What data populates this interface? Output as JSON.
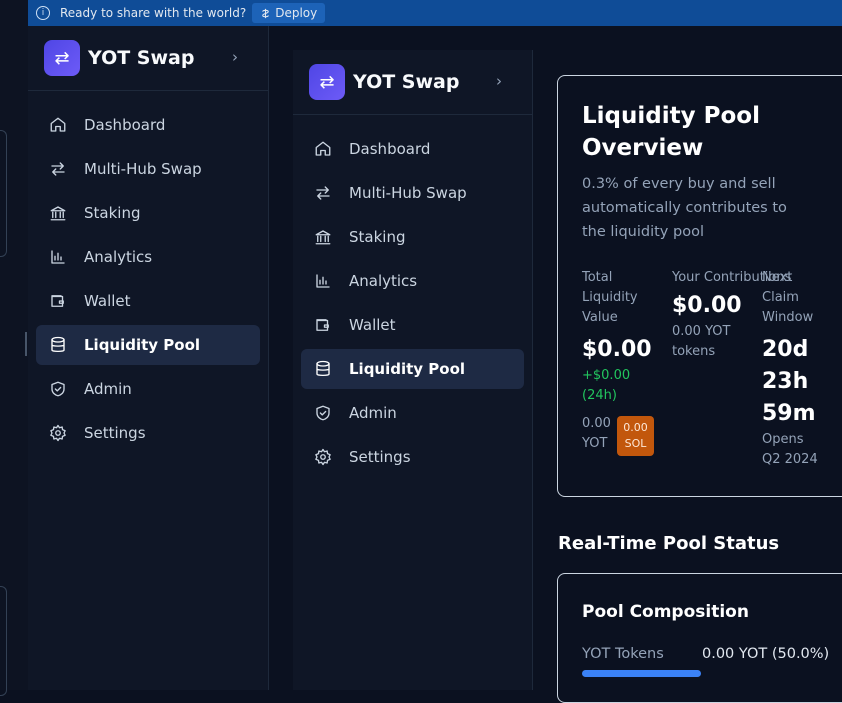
{
  "topbar": {
    "message": "Ready to share with the world?",
    "deploy_label": "Deploy"
  },
  "sidebar": {
    "brand": "YOT Swap",
    "items": [
      {
        "label": "Dashboard",
        "icon": "home-icon",
        "active": false
      },
      {
        "label": "Multi-Hub Swap",
        "icon": "swap-arrows-icon",
        "active": false
      },
      {
        "label": "Staking",
        "icon": "bank-icon",
        "active": false
      },
      {
        "label": "Analytics",
        "icon": "bar-chart-icon",
        "active": false
      },
      {
        "label": "Wallet",
        "icon": "wallet-icon",
        "active": false
      },
      {
        "label": "Liquidity Pool",
        "icon": "database-icon",
        "active": true
      },
      {
        "label": "Admin",
        "icon": "shield-check-icon",
        "active": false
      },
      {
        "label": "Settings",
        "icon": "gear-icon",
        "active": false
      }
    ]
  },
  "overview": {
    "title": "Liquidity Pool Overview",
    "description": "0.3% of every buy and sell automatically contributes to the liquidity pool",
    "total_label": "Total Liquidity Value",
    "total_value": "$0.00",
    "total_change": "+$0.00 (24h)",
    "yot_amount": "0.00 YOT",
    "sol_amount": "0.00 SOL",
    "contrib_label": "Your Contributions",
    "contrib_value": "$0.00",
    "contrib_tokens": "0.00 YOT tokens",
    "claim_label": "Next Claim Window",
    "claim_value": "20d 23h 59m",
    "claim_opens": "Opens Q2 2024"
  },
  "status": {
    "title": "Real-Time Pool Status",
    "composition_title": "Pool Composition",
    "yot_label": "YOT Tokens",
    "yot_value": "0.00 YOT (50.0%)",
    "yot_fraction": 0.5
  },
  "colors": {
    "accent": "#4f46e5",
    "active_bg": "#1e2a44",
    "positive": "#22c55e",
    "sol_badge": "#c2570c"
  }
}
